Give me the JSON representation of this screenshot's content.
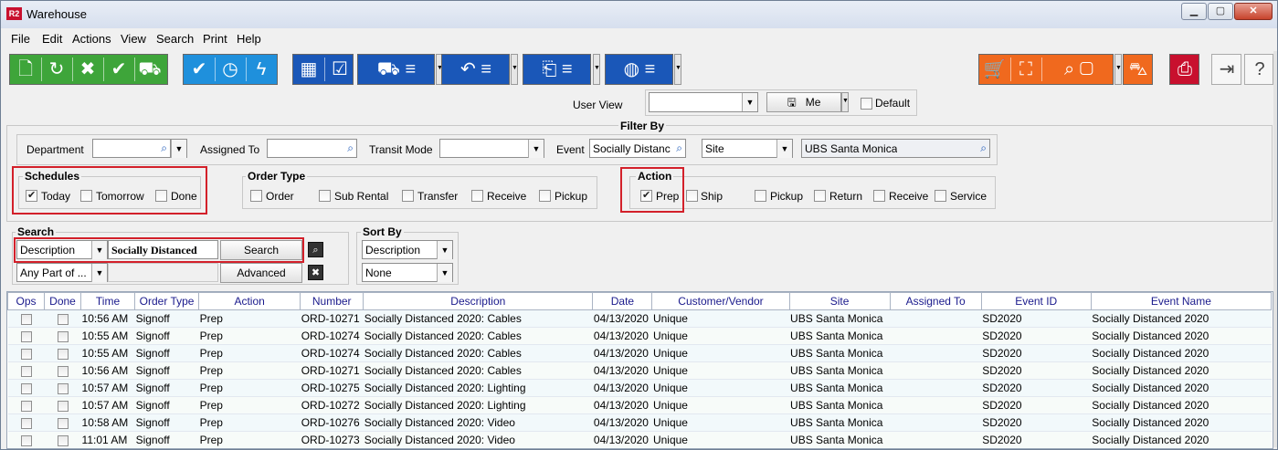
{
  "window": {
    "logo": "R2",
    "title": "Warehouse",
    "minimize": "▁",
    "maximize": "▢",
    "close": "✕"
  },
  "menu": [
    "File",
    "Edit",
    "Actions",
    "View",
    "Search",
    "Print",
    "Help"
  ],
  "toolbar_icons": [
    "new-doc-icon",
    "refresh-icon",
    "cancel-icon",
    "check-icon",
    "cart-check-icon",
    "check-circle-icon",
    "clock-check-icon",
    "lightning-icon",
    "calendar-edit-icon",
    "checkbox-icon",
    "truck-check-icon",
    "return-icon",
    "doc-return-icon",
    "bag-icon",
    "purchase-cart-icon",
    "user-scan-icon",
    "search-box-icon",
    "vehicle-icon",
    "print-icon",
    "exit-icon",
    "help-icon"
  ],
  "colors": {
    "green": "#3ea53a",
    "blue_light": "#1f90dc",
    "blue_dark": "#1a57b8",
    "orange": "#f0691e",
    "red": "#c8102e",
    "highlight": "#d3202a"
  },
  "user_view": {
    "label": "User View",
    "value": "",
    "me_label": "Me",
    "default_label": "Default"
  },
  "filter": {
    "title": "Filter By",
    "department_label": "Department",
    "department_value": "",
    "assigned_to_label": "Assigned To",
    "assigned_to_value": "",
    "transit_mode_label": "Transit Mode",
    "transit_mode_value": "",
    "event_label": "Event",
    "event_value": "Socially Distanc",
    "site_select": "Site",
    "site_value": "UBS Santa Monica"
  },
  "schedules": {
    "title": "Schedules",
    "today": "Today",
    "tomorrow": "Tomorrow",
    "done": "Done"
  },
  "order_type": {
    "title": "Order Type",
    "order": "Order",
    "sub_rental": "Sub Rental",
    "transfer": "Transfer",
    "receive": "Receive",
    "pickup": "Pickup"
  },
  "action": {
    "title": "Action",
    "prep": "Prep",
    "ship": "Ship",
    "pickup": "Pickup",
    "return": "Return",
    "receive": "Receive",
    "service": "Service"
  },
  "search": {
    "title": "Search",
    "field": "Description",
    "value": "Socially Distanced",
    "mode": "Any Part of ...",
    "search_btn": "Search",
    "advanced_btn": "Advanced"
  },
  "sort": {
    "title": "Sort By",
    "first": "Description",
    "second": "None"
  },
  "table": {
    "columns": [
      "Ops",
      "Done",
      "Time",
      "Order Type",
      "Action",
      "Number",
      "Description",
      "Date",
      "Customer/Vendor",
      "Site",
      "Assigned To",
      "Event ID",
      "Event Name"
    ],
    "rows": [
      [
        "10:56 AM",
        "Signoff",
        "Prep",
        "ORD-10271",
        "Socially Distanced 2020: Cables",
        "04/13/2020",
        "Unique",
        "UBS Santa Monica",
        "",
        "SD2020",
        "Socially Distanced 2020"
      ],
      [
        "10:55 AM",
        "Signoff",
        "Prep",
        "ORD-10274",
        "Socially Distanced 2020: Cables",
        "04/13/2020",
        "Unique",
        "UBS Santa Monica",
        "",
        "SD2020",
        "Socially Distanced 2020"
      ],
      [
        "10:55 AM",
        "Signoff",
        "Prep",
        "ORD-10274",
        "Socially Distanced 2020: Cables",
        "04/13/2020",
        "Unique",
        "UBS Santa Monica",
        "",
        "SD2020",
        "Socially Distanced 2020"
      ],
      [
        "10:56 AM",
        "Signoff",
        "Prep",
        "ORD-10271",
        "Socially Distanced 2020: Cables",
        "04/13/2020",
        "Unique",
        "UBS Santa Monica",
        "",
        "SD2020",
        "Socially Distanced 2020"
      ],
      [
        "10:57 AM",
        "Signoff",
        "Prep",
        "ORD-10275",
        "Socially Distanced 2020: Lighting",
        "04/13/2020",
        "Unique",
        "UBS Santa Monica",
        "",
        "SD2020",
        "Socially Distanced 2020"
      ],
      [
        "10:57 AM",
        "Signoff",
        "Prep",
        "ORD-10272",
        "Socially Distanced 2020: Lighting",
        "04/13/2020",
        "Unique",
        "UBS Santa Monica",
        "",
        "SD2020",
        "Socially Distanced 2020"
      ],
      [
        "10:58 AM",
        "Signoff",
        "Prep",
        "ORD-10276",
        "Socially Distanced 2020: Video",
        "04/13/2020",
        "Unique",
        "UBS Santa Monica",
        "",
        "SD2020",
        "Socially Distanced 2020"
      ],
      [
        "11:01 AM",
        "Signoff",
        "Prep",
        "ORD-10273",
        "Socially Distanced 2020: Video",
        "04/13/2020",
        "Unique",
        "UBS Santa Monica",
        "",
        "SD2020",
        "Socially Distanced 2020"
      ]
    ]
  }
}
